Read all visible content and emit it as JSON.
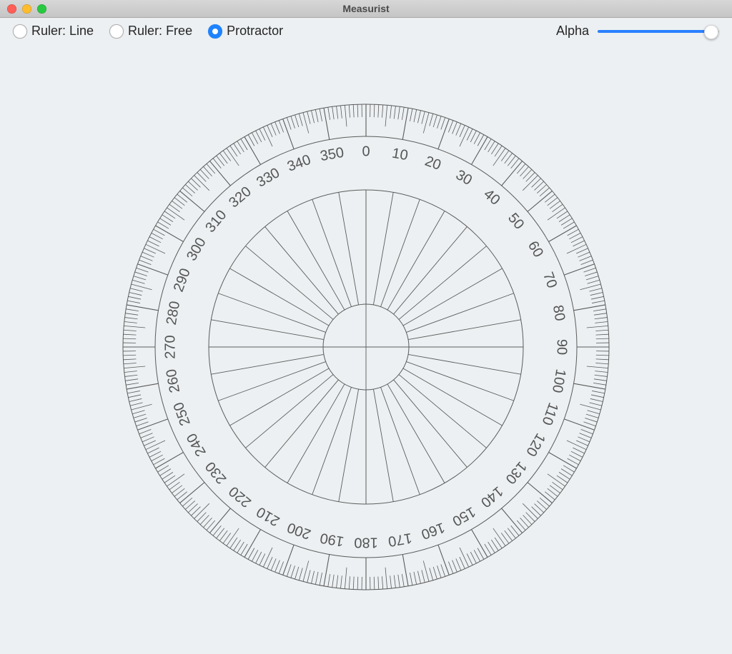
{
  "window": {
    "title": "Measurist"
  },
  "toolbar": {
    "modes": [
      {
        "key": "ruler_line",
        "label": "Ruler: Line",
        "selected": false
      },
      {
        "key": "ruler_free",
        "label": "Ruler: Free",
        "selected": false
      },
      {
        "key": "protractor",
        "label": "Protractor",
        "selected": true
      }
    ],
    "slider": {
      "label": "Alpha",
      "value": 0.93,
      "min": 0,
      "max": 1
    }
  },
  "protractor": {
    "degree_labels": [
      0,
      10,
      20,
      30,
      40,
      50,
      60,
      70,
      80,
      90,
      100,
      110,
      120,
      130,
      140,
      150,
      160,
      170,
      180,
      190,
      200,
      210,
      220,
      230,
      240,
      250,
      260,
      270,
      280,
      290,
      300,
      310,
      320,
      330,
      340,
      350
    ],
    "tick_step_minor_deg": 1,
    "tick_step_medium_deg": 5,
    "tick_step_major_deg": 10,
    "radial_step_deg": 10,
    "label_radius_px": 273,
    "outer_radius_px": 340,
    "inner_radius_px": 220,
    "hub_radius_px": 60
  },
  "colors": {
    "accent": "#1f83ff",
    "line": "#5b5b5b",
    "bg": "#ecf0f2"
  }
}
